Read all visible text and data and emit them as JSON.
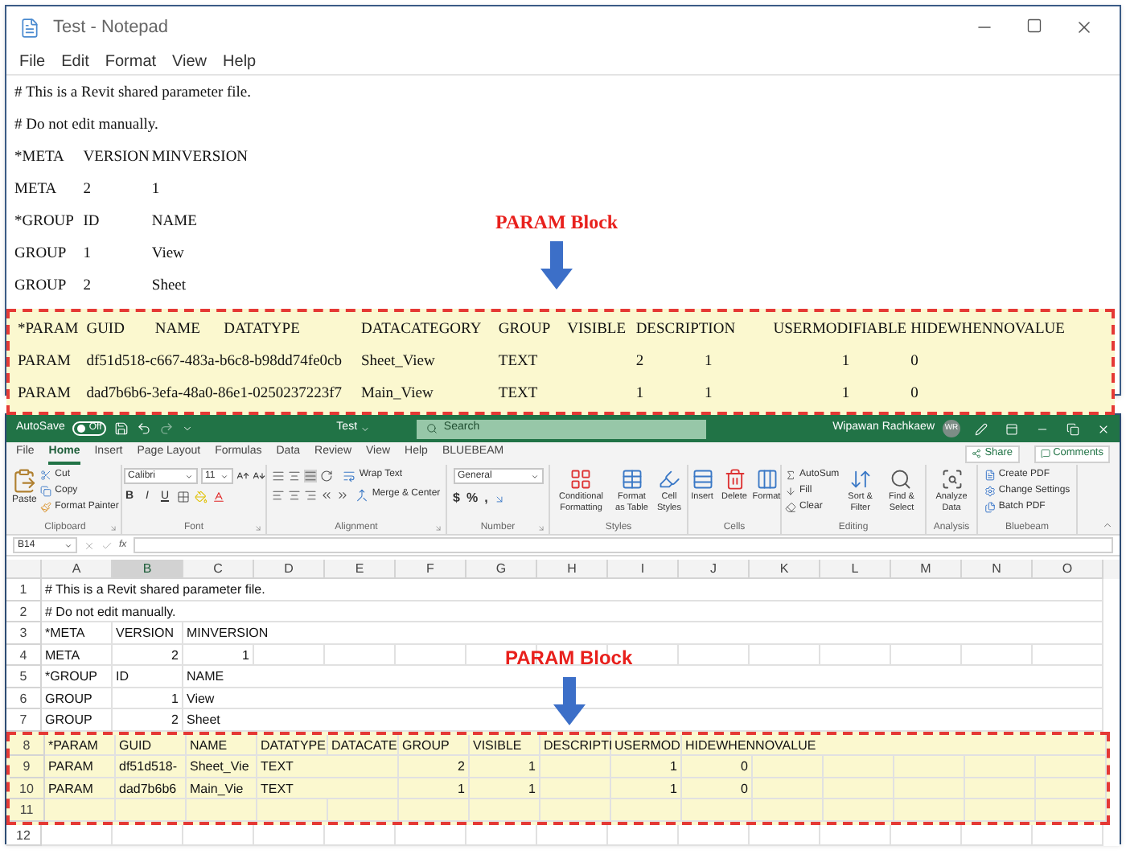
{
  "notepad": {
    "title": "Test - Notepad",
    "menu": [
      "File",
      "Edit",
      "Format",
      "View",
      "Help"
    ],
    "lines": [
      {
        "text": "# This is a Revit shared parameter file.",
        "highlighted": false
      },
      {
        "text": "# Do not edit manually.",
        "highlighted": false
      },
      {
        "text": "*META\tVERSION\tMINVERSION",
        "highlighted": false
      },
      {
        "text": "META\t2\t1",
        "highlighted": false
      },
      {
        "text": "*GROUP\tID\tNAME",
        "highlighted": false
      },
      {
        "text": "GROUP\t1\tView",
        "highlighted": false
      },
      {
        "text": "GROUP\t2\tSheet",
        "highlighted": false
      },
      {
        "text": "*PARAM\tGUID\tNAME\tDATATYPE\tDATACATEGORY\tGROUP\tVISIBLE\tDESCRIPTION\tUSERMODIFIABLE\tHIDEWHENNOVALUE",
        "highlighted": true
      },
      {
        "text": "PARAM\tdf51d518-c667-483a-b6c8-b98dd74fe0cb\tSheet_View\tTEXT\t\t2\t1\t\t1\t0",
        "highlighted": true
      },
      {
        "text": "PARAM\tdad7b6b6-3efa-48a0-86e1-0250237223f7\tMain_View\tTEXT\t\t1\t1\t\t1\t0",
        "highlighted": true
      }
    ],
    "annotation": {
      "label": "PARAM Block"
    }
  },
  "excel": {
    "title_bar": {
      "autosave_label": "AutoSave",
      "autosave": {
        "label": "Off",
        "on": false
      },
      "document": "Test",
      "search": {
        "placeholder": "Search"
      },
      "user": "Wipawan Rachkaew",
      "avatar": "WR"
    },
    "tabs": [
      {
        "label": "File",
        "selected": false
      },
      {
        "label": "Home",
        "selected": true
      },
      {
        "label": "Insert",
        "selected": false
      },
      {
        "label": "Page Layout",
        "selected": false
      },
      {
        "label": "Formulas",
        "selected": false
      },
      {
        "label": "Data",
        "selected": false
      },
      {
        "label": "Review",
        "selected": false
      },
      {
        "label": "View",
        "selected": false
      },
      {
        "label": "Help",
        "selected": false
      },
      {
        "label": "BLUEBEAM",
        "selected": false
      }
    ],
    "share": "Share",
    "comments": "Comments",
    "ribbon_groups": [
      {
        "kind": "clipboard",
        "label": "Clipboard",
        "paste": "Paste",
        "cut": "Cut",
        "copy": "Copy",
        "format_painter": "Format Painter"
      },
      {
        "kind": "font",
        "label": "Font",
        "font_name": "Calibri",
        "font_size": "11",
        "styles": [
          "B",
          "I",
          "U"
        ]
      },
      {
        "kind": "alignment",
        "label": "Alignment",
        "wrap": "Wrap Text",
        "merge": "Merge & Center"
      },
      {
        "kind": "number",
        "label": "Number",
        "format": "General",
        "symbols": [
          "$",
          "%",
          ","
        ]
      },
      {
        "kind": "styles",
        "label": "Styles",
        "buttons": [
          "Conditional Formatting",
          "Format as Table",
          "Cell Styles"
        ]
      },
      {
        "kind": "cells",
        "label": "Cells",
        "buttons": [
          "Insert",
          "Delete",
          "Format"
        ]
      },
      {
        "kind": "editing",
        "label": "Editing",
        "small": [
          "AutoSum",
          "Fill",
          "Clear"
        ],
        "buttons": [
          "Sort & Filter",
          "Find & Select"
        ]
      },
      {
        "kind": "analysis",
        "label": "Analysis",
        "buttons": [
          "Analyze Data"
        ]
      },
      {
        "kind": "bluebeam",
        "label": "Bluebeam",
        "buttons": [
          "Create PDF",
          "Change Settings",
          "Batch PDF"
        ]
      }
    ],
    "formula_bar": {
      "name_box": "B14",
      "function_label": "fx"
    },
    "columns": [
      {
        "label": "A",
        "selected": false
      },
      {
        "label": "B",
        "selected": true
      },
      {
        "label": "C",
        "selected": false
      },
      {
        "label": "D",
        "selected": false
      },
      {
        "label": "E",
        "selected": false
      },
      {
        "label": "F",
        "selected": false
      },
      {
        "label": "G",
        "selected": false
      },
      {
        "label": "H",
        "selected": false
      },
      {
        "label": "I",
        "selected": false
      },
      {
        "label": "J",
        "selected": false
      },
      {
        "label": "K",
        "selected": false
      },
      {
        "label": "L",
        "selected": false
      },
      {
        "label": "M",
        "selected": false
      },
      {
        "label": "N",
        "selected": false
      },
      {
        "label": "O",
        "selected": false
      }
    ],
    "rows": [
      {
        "label": "1",
        "highlighted": false,
        "cells": [
          {
            "kind": "text",
            "value": "# This is a Revit shared parameter file."
          }
        ]
      },
      {
        "label": "2",
        "highlighted": false,
        "cells": [
          {
            "kind": "text",
            "value": "# Do not edit manually."
          }
        ]
      },
      {
        "label": "3",
        "highlighted": false,
        "cells": [
          {
            "kind": "text",
            "value": "*META"
          },
          {
            "kind": "text",
            "value": "VERSION"
          },
          {
            "kind": "text",
            "value": "MINVERSION"
          }
        ]
      },
      {
        "label": "4",
        "highlighted": false,
        "cells": [
          {
            "kind": "text",
            "value": "META"
          },
          {
            "kind": "number",
            "value": "2"
          },
          {
            "kind": "number",
            "value": "1"
          }
        ]
      },
      {
        "label": "5",
        "highlighted": false,
        "cells": [
          {
            "kind": "text",
            "value": "*GROUP"
          },
          {
            "kind": "text",
            "value": "ID"
          },
          {
            "kind": "text",
            "value": "NAME"
          }
        ]
      },
      {
        "label": "6",
        "highlighted": false,
        "cells": [
          {
            "kind": "text",
            "value": "GROUP"
          },
          {
            "kind": "number",
            "value": "1"
          },
          {
            "kind": "text",
            "value": "View"
          }
        ]
      },
      {
        "label": "7",
        "highlighted": false,
        "cells": [
          {
            "kind": "text",
            "value": "GROUP"
          },
          {
            "kind": "number",
            "value": "2"
          },
          {
            "kind": "text",
            "value": "Sheet"
          }
        ]
      },
      {
        "label": "8",
        "highlighted": true,
        "cells": [
          {
            "kind": "text",
            "value": "*PARAM"
          },
          {
            "kind": "text",
            "value": "GUID"
          },
          {
            "kind": "text",
            "value": "NAME"
          },
          {
            "kind": "text",
            "value": "DATATYPE"
          },
          {
            "kind": "text",
            "value": "DATACATE"
          },
          {
            "kind": "text",
            "value": "GROUP"
          },
          {
            "kind": "text",
            "value": "VISIBLE"
          },
          {
            "kind": "text",
            "value": "DESCRIPTI"
          },
          {
            "kind": "text",
            "value": "USERMOD"
          },
          {
            "kind": "text",
            "value": "HIDEWHENNOVALUE"
          }
        ]
      },
      {
        "label": "9",
        "highlighted": true,
        "cells": [
          {
            "kind": "text",
            "value": "PARAM"
          },
          {
            "kind": "text",
            "value": "df51d518-"
          },
          {
            "kind": "text",
            "value": "Sheet_Vie"
          },
          {
            "kind": "text",
            "value": "TEXT"
          },
          {
            "kind": "blank"
          },
          {
            "kind": "number",
            "value": "2"
          },
          {
            "kind": "number",
            "value": "1"
          },
          {
            "kind": "blank"
          },
          {
            "kind": "number",
            "value": "1"
          },
          {
            "kind": "number",
            "value": "0"
          }
        ]
      },
      {
        "label": "10",
        "highlighted": true,
        "cells": [
          {
            "kind": "text",
            "value": "PARAM"
          },
          {
            "kind": "text",
            "value": "dad7b6b6"
          },
          {
            "kind": "text",
            "value": "Main_Vie"
          },
          {
            "kind": "text",
            "value": "TEXT"
          },
          {
            "kind": "blank"
          },
          {
            "kind": "number",
            "value": "1"
          },
          {
            "kind": "number",
            "value": "1"
          },
          {
            "kind": "blank"
          },
          {
            "kind": "number",
            "value": "1"
          },
          {
            "kind": "number",
            "value": "0"
          }
        ]
      },
      {
        "label": "11",
        "highlighted": true
      },
      {
        "label": "12",
        "highlighted": false
      }
    ],
    "annotation": {
      "label": "PARAM Block"
    }
  }
}
